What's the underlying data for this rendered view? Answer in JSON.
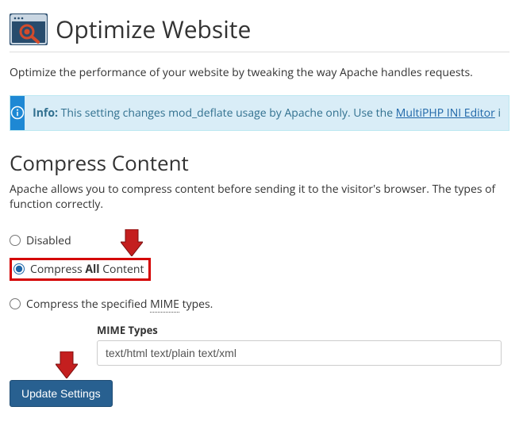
{
  "header": {
    "title": "Optimize Website"
  },
  "intro": "Optimize the performance of your website by tweaking the way Apache handles requests.",
  "callout": {
    "info_label": "Info:",
    "text_before_link": " This setting changes mod_deflate usage by Apache only. Use the ",
    "link_text": "MultiPHP INI Editor",
    "text_after_link": " i"
  },
  "section": {
    "heading": "Compress Content",
    "desc": "Apache allows you to compress content before sending it to the visitor's browser. The types of function correctly."
  },
  "options": {
    "disabled": "Disabled",
    "compress_all_pre": "Compress ",
    "compress_all_bold": "All",
    "compress_all_post": " Content",
    "compress_mime_pre": "Compress the specified ",
    "compress_mime_mime": "MIME",
    "compress_mime_post": " types."
  },
  "mime": {
    "label": "MIME Types",
    "value": "text/html text/plain text/xml"
  },
  "button": {
    "update": "Update Settings"
  }
}
